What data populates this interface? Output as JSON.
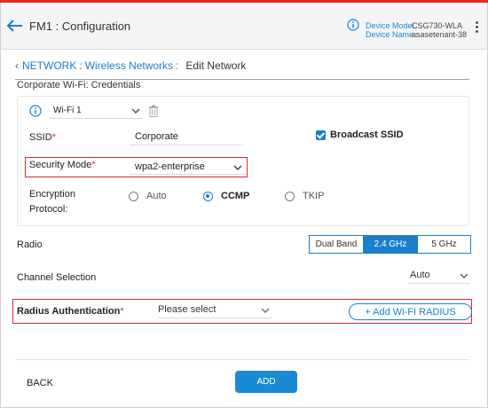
{
  "header": {
    "title": "FM1 : Configuration",
    "device_model_label": "Device Model",
    "device_name_label": "Device Name :",
    "device_model_value": "CSG730-WLA",
    "device_name_value": "asasetenant-38"
  },
  "breadcrumb": {
    "network": "NETWORK",
    "wireless": "Wireless Networks",
    "sep": ":",
    "current": "Edit Network"
  },
  "section_title": "Corporate Wi-Fi: Credentials",
  "wifi": {
    "selected": "Wi-Fi 1",
    "ssid_label": "SSID",
    "ssid_value": "Corporate",
    "broadcast_label": "Broadcast SSID",
    "broadcast_checked": true,
    "security_label": "Security Mode",
    "security_value": "wpa2-enterprise",
    "encryption_label_1": "Encryption",
    "encryption_label_2": "Protocol:",
    "encryption_options": [
      "Auto",
      "CCMP",
      "TKIP"
    ],
    "encryption_selected": "CCMP"
  },
  "radio": {
    "label": "Radio",
    "bands": [
      "Dual Band",
      "2.4 GHz",
      "5 GHz"
    ],
    "selected": "2.4 GHz"
  },
  "channel": {
    "label": "Channel Selection",
    "value": "Auto"
  },
  "radius": {
    "label": "Radius Authentication",
    "placeholder": "Please select",
    "add_button": "+ Add Wi-FI RADIUS"
  },
  "required_marker": "*",
  "footer": {
    "back": "BACK",
    "add": "ADD"
  },
  "colors": {
    "accent": "#1a7fcc",
    "highlight": "#e0282f"
  }
}
